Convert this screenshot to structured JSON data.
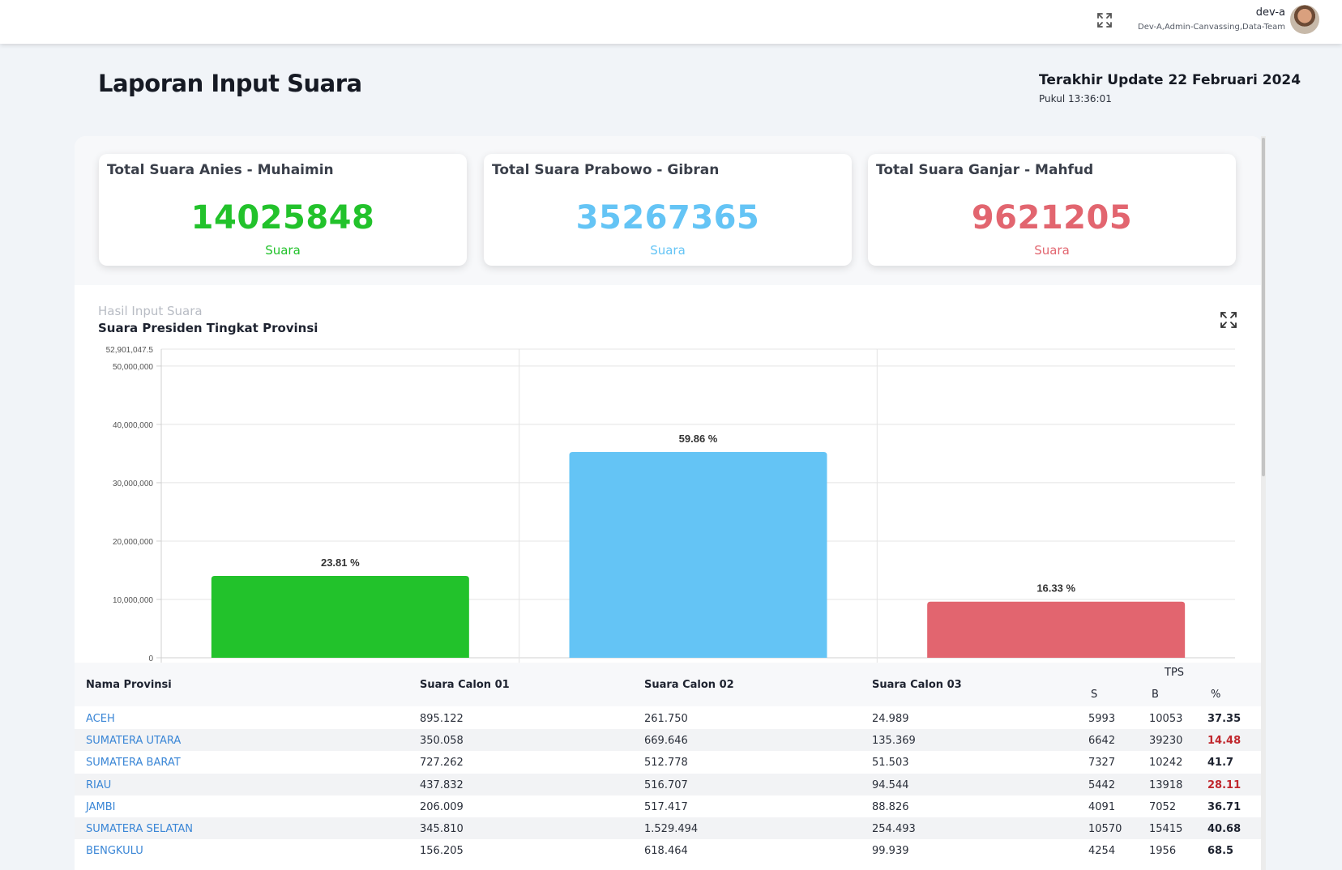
{
  "topbar": {
    "user_name": "dev-a",
    "user_roles": "Dev-A,Admin-Canvassing,Data-Team"
  },
  "page": {
    "title": "Laporan Input Suara",
    "update_line": "Terakhir Update 22 Februari 2024",
    "update_time": "Pukul 13:36:01"
  },
  "cards": [
    {
      "title": "Total Suara Anies - Muhaimin",
      "value": "14025848",
      "unit": "Suara",
      "color": "#22c22b"
    },
    {
      "title": "Total Suara Prabowo - Gibran",
      "value": "35267365",
      "unit": "Suara",
      "color": "#64c4f5"
    },
    {
      "title": "Total Suara Ganjar - Mahfud",
      "value": "9621205",
      "unit": "Suara",
      "color": "#e2656f"
    }
  ],
  "chart_section": {
    "subtitle": "Hasil Input Suara",
    "title": "Suara Presiden Tingkat Provinsi"
  },
  "chart_data": {
    "type": "bar",
    "title": "Suara Presiden Tingkat Provinsi",
    "values": [
      14025848,
      35267365,
      9621205
    ],
    "labels": [
      "23.81 %",
      "59.86 %",
      "16.33 %"
    ],
    "colors": [
      "#22c22b",
      "#64c4f5",
      "#e2656f"
    ],
    "ylim": [
      0,
      52901047.5
    ],
    "ytick_values": [
      0,
      10000000,
      20000000,
      30000000,
      40000000,
      50000000
    ],
    "ytick_labels": [
      "0",
      "10,000,000",
      "20,000,000",
      "30,000,000",
      "40,000,000",
      "50,000,000"
    ],
    "ymax_label": "52,901,047.5",
    "grid": true
  },
  "table": {
    "headers": {
      "province": "Nama Provinsi",
      "c1": "Suara Calon 01",
      "c2": "Suara Calon 02",
      "c3": "Suara Calon 03",
      "tps": "TPS",
      "s": "S",
      "b": "B",
      "pct": "%"
    },
    "rows": [
      {
        "province": "ACEH",
        "c1": "895.122",
        "c2": "261.750",
        "c3": "24.989",
        "s": "5993",
        "b": "10053",
        "pct": "37.35",
        "low": false
      },
      {
        "province": "SUMATERA UTARA",
        "c1": "350.058",
        "c2": "669.646",
        "c3": "135.369",
        "s": "6642",
        "b": "39230",
        "pct": "14.48",
        "low": true
      },
      {
        "province": "SUMATERA BARAT",
        "c1": "727.262",
        "c2": "512.778",
        "c3": "51.503",
        "s": "7327",
        "b": "10242",
        "pct": "41.7",
        "low": false
      },
      {
        "province": "RIAU",
        "c1": "437.832",
        "c2": "516.707",
        "c3": "94.544",
        "s": "5442",
        "b": "13918",
        "pct": "28.11",
        "low": true
      },
      {
        "province": "JAMBI",
        "c1": "206.009",
        "c2": "517.417",
        "c3": "88.826",
        "s": "4091",
        "b": "7052",
        "pct": "36.71",
        "low": false
      },
      {
        "province": "SUMATERA SELATAN",
        "c1": "345.810",
        "c2": "1.529.494",
        "c3": "254.493",
        "s": "10570",
        "b": "15415",
        "pct": "40.68",
        "low": false
      },
      {
        "province": "BENGKULU",
        "c1": "156.205",
        "c2": "618.464",
        "c3": "99.939",
        "s": "4254",
        "b": "1956",
        "pct": "68.5",
        "low": false
      }
    ]
  }
}
